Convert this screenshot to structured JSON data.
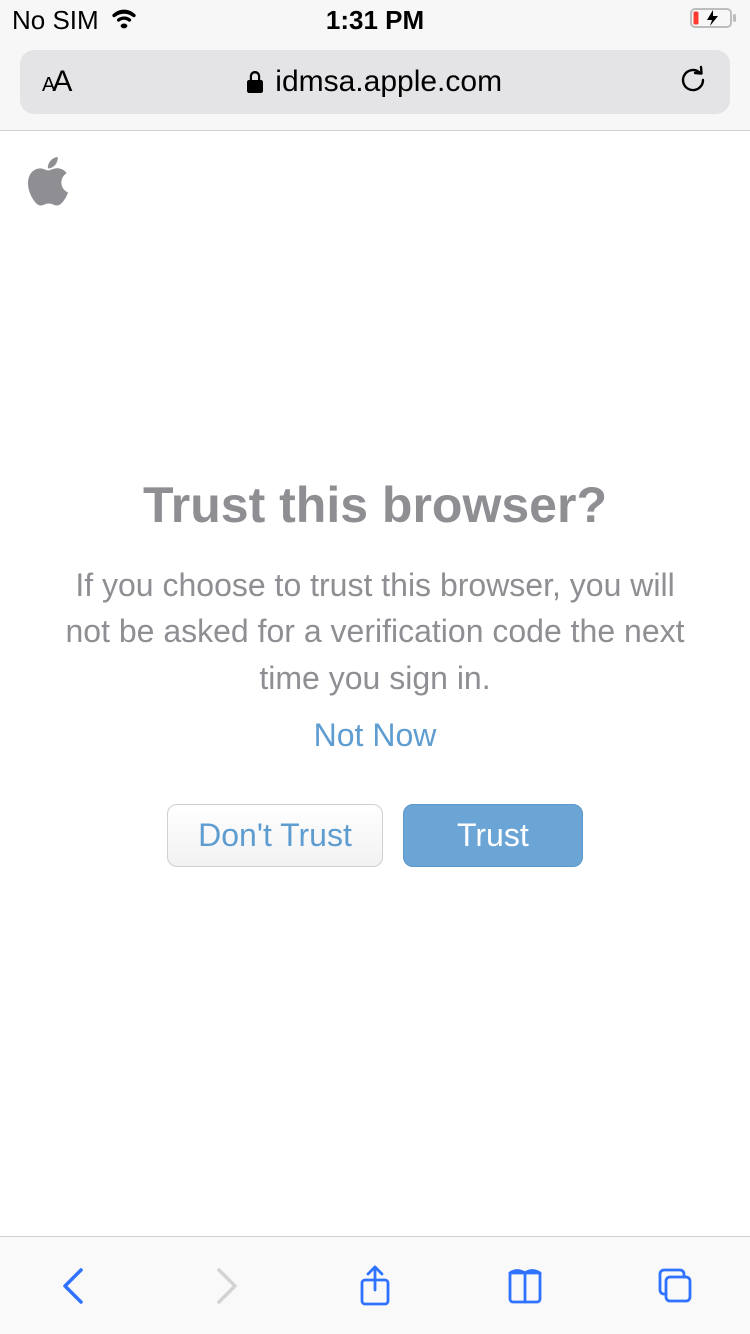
{
  "status_bar": {
    "carrier": "No SIM",
    "time": "1:31 PM"
  },
  "url_bar": {
    "domain": "idmsa.apple.com"
  },
  "dialog": {
    "title": "Trust this browser?",
    "description": "If you choose to trust this browser, you will not be asked for a verification code the next time you sign in.",
    "not_now_label": "Not Now",
    "dont_trust_label": "Don't Trust",
    "trust_label": "Trust"
  }
}
